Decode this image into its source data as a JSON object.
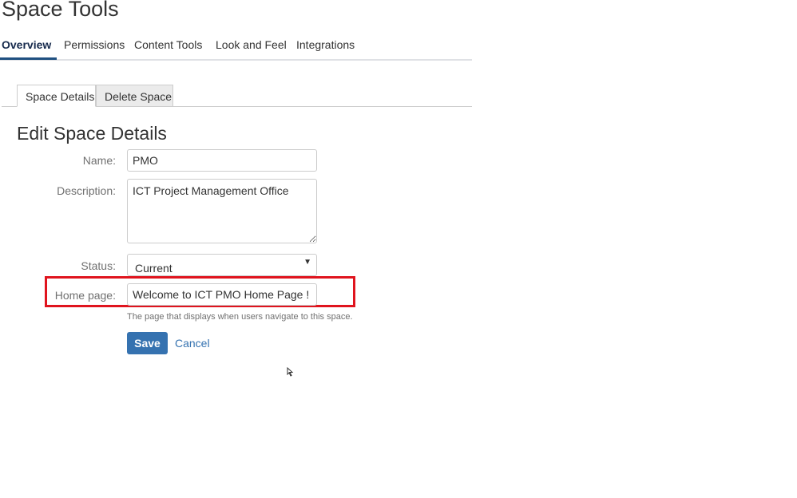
{
  "page_title": "Space Tools",
  "top_nav": [
    {
      "label": "Overview",
      "active": true
    },
    {
      "label": "Permissions",
      "active": false
    },
    {
      "label": "Content Tools",
      "active": false
    },
    {
      "label": "Look and Feel",
      "active": false
    },
    {
      "label": "Integrations",
      "active": false
    }
  ],
  "sub_tabs": [
    {
      "label": "Space Details",
      "active": true
    },
    {
      "label": "Delete Space",
      "active": false
    }
  ],
  "form": {
    "title": "Edit Space Details",
    "name_label": "Name:",
    "name_value": "PMO",
    "description_label": "Description:",
    "description_value": "ICT Project Management Office",
    "status_label": "Status:",
    "status_value": "Current",
    "home_page_label": "Home page:",
    "home_page_value": "Welcome to ICT PMO Home Page !",
    "home_page_help": "The page that displays when users navigate to this space.",
    "save_label": "Save",
    "cancel_label": "Cancel"
  },
  "colors": {
    "accent": "#3572b0",
    "highlight": "#e0141e",
    "nav_active_underline": "#205081"
  },
  "icons": {
    "status_dropdown": "caret-down-icon",
    "cursor": "mouse-cursor-icon"
  }
}
